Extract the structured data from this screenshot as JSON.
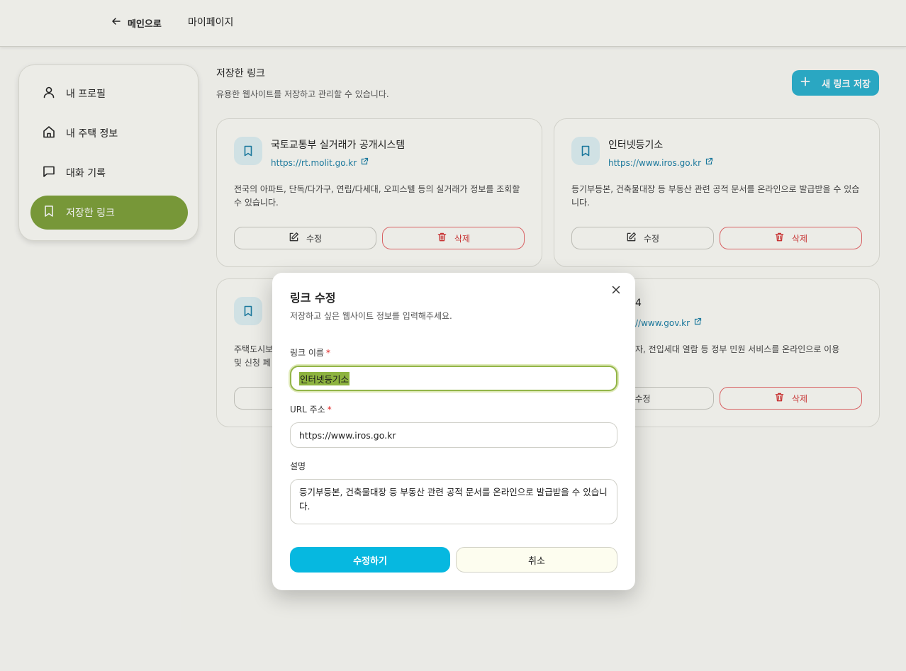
{
  "header": {
    "back_label": "메인으로",
    "page_title": "마이페이지"
  },
  "sidebar": {
    "items": [
      {
        "label": "내 프로필",
        "icon": "user-icon"
      },
      {
        "label": "내 주택 정보",
        "icon": "home-icon"
      },
      {
        "label": "대화 기록",
        "icon": "chat-icon"
      },
      {
        "label": "저장한 링크",
        "icon": "bookmark-icon",
        "active": true
      }
    ]
  },
  "main": {
    "title": "저장한 링크",
    "description": "유용한 웹사이트를 저장하고 관리할 수 있습니다.",
    "new_button": "새 링크 저장",
    "cards": [
      {
        "title": "국토교통부 실거래가 공개시스템",
        "url": "https://rt.molit.go.kr",
        "description": "전국의 아파트, 단독/다가구, 연립/다세대, 오피스텔 등의 실거래가 정보를 조회할 수 있습니다.",
        "edit_label": "수정",
        "delete_label": "삭제"
      },
      {
        "title": "인터넷등기소",
        "url": "https://www.iros.go.kr",
        "description": "등기부등본, 건축물대장 등 부동산 관련 공적 문서를 온라인으로 발급받을 수 있습니다.",
        "edit_label": "수정",
        "delete_label": "삭제"
      },
      {
        "title": "",
        "url": "",
        "description": "주택도시보\n및 신청 페",
        "edit_label": "",
        "delete_label": ""
      },
      {
        "title": "4",
        "url": "//www.gov.kr",
        "description": "자, 전입세대 열람 등 정부 민원 서비스를 온라인으로 이용",
        "edit_label": "수정",
        "delete_label": "삭제"
      }
    ]
  },
  "modal": {
    "title": "링크 수정",
    "subtitle": "저장하고 싶은 웹사이트 정보를 입력해주세요.",
    "name_label": "링크 이름",
    "name_value": "인터넷등기소",
    "url_label": "URL 주소",
    "url_value": "https://www.iros.go.kr",
    "desc_label": "설명",
    "desc_value": "등기부등본, 건축물대장 등 부동산 관련 공적 문서를 온라인으로 발급받을 수 있습니다.",
    "required_mark": "*",
    "submit_label": "수정하기",
    "cancel_label": "취소"
  },
  "colors": {
    "accent_green": "#7ea13a",
    "accent_cyan": "#06b8e0",
    "danger_red": "#d53434",
    "link_blue": "#1a7fa6"
  }
}
